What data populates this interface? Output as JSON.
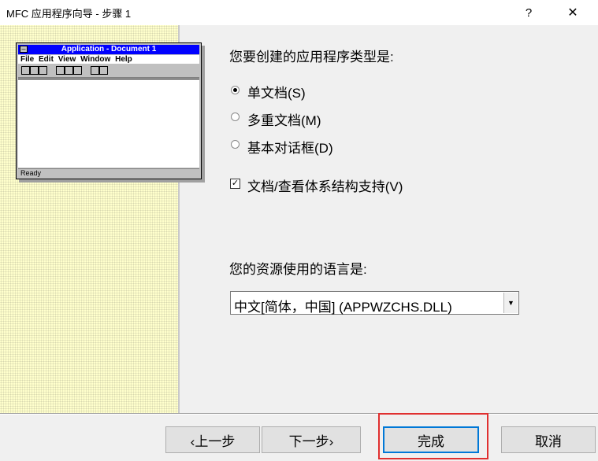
{
  "window": {
    "title": "MFC 应用程序向导 - 步骤 1",
    "help_glyph": "?",
    "close_glyph": "✕"
  },
  "preview": {
    "title": "Application - Document 1",
    "sys_glyph": "–",
    "menu": [
      "File",
      "Edit",
      "View",
      "Window",
      "Help"
    ],
    "status": "Ready"
  },
  "app_type": {
    "prompt": "您要创建的应用程序类型是:",
    "options": [
      {
        "label": "单文档(S)",
        "selected": true
      },
      {
        "label": "多重文档(M)",
        "selected": false
      },
      {
        "label": "基本对话框(D)",
        "selected": false
      }
    ],
    "docview": {
      "label": "文档/查看体系结构支持(V)",
      "checked": true,
      "check_glyph": "✓"
    }
  },
  "language": {
    "prompt": "您的资源使用的语言是:",
    "selected": "中文[简体，中国] (APPWZCHS.DLL)",
    "arrow_glyph": "▼"
  },
  "footer": {
    "back_label": "‹上一步",
    "next_label": "下一步›",
    "finish_label": "完成",
    "cancel_label": "取消"
  },
  "colors": {
    "left_panel": "#ffffcc",
    "preview_titlebar": "#0000ff",
    "highlight_box": "#e03030"
  },
  "icons": [
    "help-icon",
    "close-icon",
    "chevron-down-icon"
  ]
}
